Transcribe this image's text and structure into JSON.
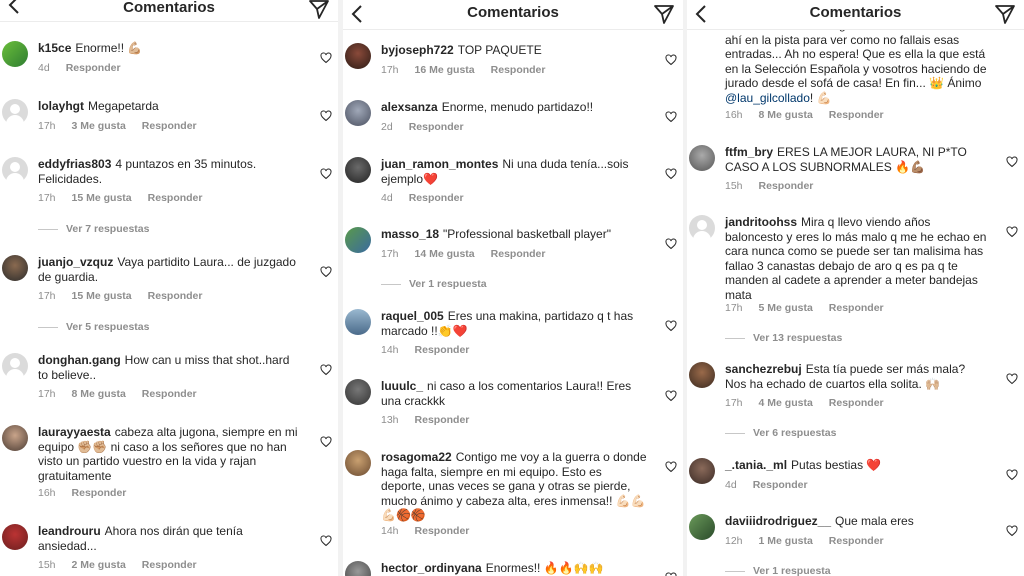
{
  "header": {
    "title": "Comentarios"
  },
  "panel1": {
    "comments": [
      {
        "user": "k15ce",
        "text": "Enorme!! 💪🏼",
        "time": "4d",
        "likes": "",
        "reply": "Responder",
        "more": ""
      },
      {
        "user": "lolayhgt",
        "text": "Megapetarda",
        "time": "17h",
        "likes": "3 Me gusta",
        "reply": "Responder",
        "more": ""
      },
      {
        "user": "eddyfrias803",
        "text": "4 puntazos en 35 minutos. Felicidades.",
        "time": "17h",
        "likes": "15 Me gusta",
        "reply": "Responder",
        "more": "Ver 7 respuestas"
      },
      {
        "user": "juanjo_vzquz",
        "text": "Vaya partidito Laura... de juzgado de guardia.",
        "time": "17h",
        "likes": "15 Me gusta",
        "reply": "Responder",
        "more": "Ver 5 respuestas"
      },
      {
        "user": "donghan.gang",
        "text": "How can u miss that shot..hard to believe..",
        "time": "17h",
        "likes": "8 Me gusta",
        "reply": "Responder",
        "more": ""
      },
      {
        "user": "laurayyaesta",
        "text": "cabeza alta jugona, siempre en mi equipo ✊🏼✊🏼 ni caso a los señores que no han visto un partido vuestro en la vida y rajan gratuitamente",
        "time": "16h",
        "likes": "",
        "reply": "Responder",
        "more": ""
      },
      {
        "user": "leandrouru",
        "text": "Ahora nos dirán que tenía ansiedad...",
        "time": "15h",
        "likes": "2 Me gusta",
        "reply": "Responder",
        "more": ""
      }
    ]
  },
  "panel2": {
    "comments": [
      {
        "user": "byjoseph722",
        "text": "TOP PAQUETE",
        "time": "17h",
        "likes": "16 Me gusta",
        "reply": "Responder",
        "more": ""
      },
      {
        "user": "alexsanza",
        "text": "Enorme, menudo partidazo!!",
        "time": "2d",
        "likes": "",
        "reply": "Responder",
        "more": ""
      },
      {
        "user": "juan_ramon_montes",
        "text": "Ni una duda tenía...sois ejemplo❤️",
        "time": "4d",
        "likes": "",
        "reply": "Responder",
        "more": ""
      },
      {
        "user": "masso_18",
        "text": "\"Professional basketball player\"",
        "time": "17h",
        "likes": "14 Me gusta",
        "reply": "Responder",
        "more": "Ver 1 respuesta"
      },
      {
        "user": "raquel_005",
        "text": "Eres una makina, partidazo q t has marcado !!👏❤️",
        "time": "14h",
        "likes": "",
        "reply": "Responder",
        "more": ""
      },
      {
        "user": "luuulc_",
        "text": "ni caso a los comentarios Laura!! Eres una crackkk",
        "time": "13h",
        "likes": "",
        "reply": "Responder",
        "more": ""
      },
      {
        "user": "rosagoma22",
        "text": "Contigo me voy a la guerra o donde haga falta, siempre en mi equipo. Esto es deporte, unas veces se gana y otras se pierde, mucho ánimo y cabeza alta, eres inmensa!! 💪🏻💪🏻💪🏻🏀🏀",
        "time": "14h",
        "likes": "",
        "reply": "Responder",
        "more": ""
      },
      {
        "user": "hector_ordinyana",
        "text": "Enormes!! 🔥🔥🙌🙌",
        "time": "",
        "likes": "",
        "reply": "",
        "more": ""
      }
    ]
  },
  "panel3": {
    "partial": {
      "text_before": "con la Selección. Me gustaría veros a vosotros ahí en la pista para ver como no fallais esas entradas... Ah no espera! Que es ella la que está en la Selección Española y vosotros haciendo de jurado desde el sofá de casa! En fin... 👑 Ánimo ",
      "mention": "@lau_gilcollado",
      "text_after": "! 💪🏻",
      "time": "16h",
      "likes": "8 Me gusta",
      "reply": "Responder"
    },
    "comments": [
      {
        "user": "ftfm_bry",
        "text": "ERES LA MEJOR LAURA, NI P*TO CASO A LOS SUBNORMALES 🔥💪🏽",
        "time": "15h",
        "likes": "",
        "reply": "Responder",
        "more": ""
      },
      {
        "user": "jandritoohss",
        "text": "Mira q llevo viendo años baloncesto y eres lo más malo q me he echao en cara nunca como se puede ser tan malisima has fallao 3 canastas debajo de aro q es pa q te manden al cadete a aprender a meter bandejas mata",
        "time": "17h",
        "likes": "5 Me gusta",
        "reply": "Responder",
        "more": "Ver 13 respuestas"
      },
      {
        "user": "sanchezrebuj",
        "text": "Esta tía puede ser más mala? Nos ha echado de cuartos ella solita. 🙌🏼",
        "time": "17h",
        "likes": "4 Me gusta",
        "reply": "Responder",
        "more": "Ver 6 respuestas"
      },
      {
        "user": "_.tania._ml",
        "text": "Putas bestias ❤️",
        "time": "4d",
        "likes": "",
        "reply": "Responder",
        "more": ""
      },
      {
        "user": "daviiidrodriguez__",
        "text": "Que mala eres",
        "time": "12h",
        "likes": "1 Me gusta",
        "reply": "Responder",
        "more": "Ver 1 respuesta"
      }
    ]
  },
  "icons": {
    "back": "chevron-left-icon",
    "send": "paper-plane-icon",
    "like": "heart-outline-icon"
  },
  "colors": {
    "text": "#262626",
    "meta": "#8e8e8e",
    "mention": "#00376b",
    "divider": "#ececec"
  }
}
